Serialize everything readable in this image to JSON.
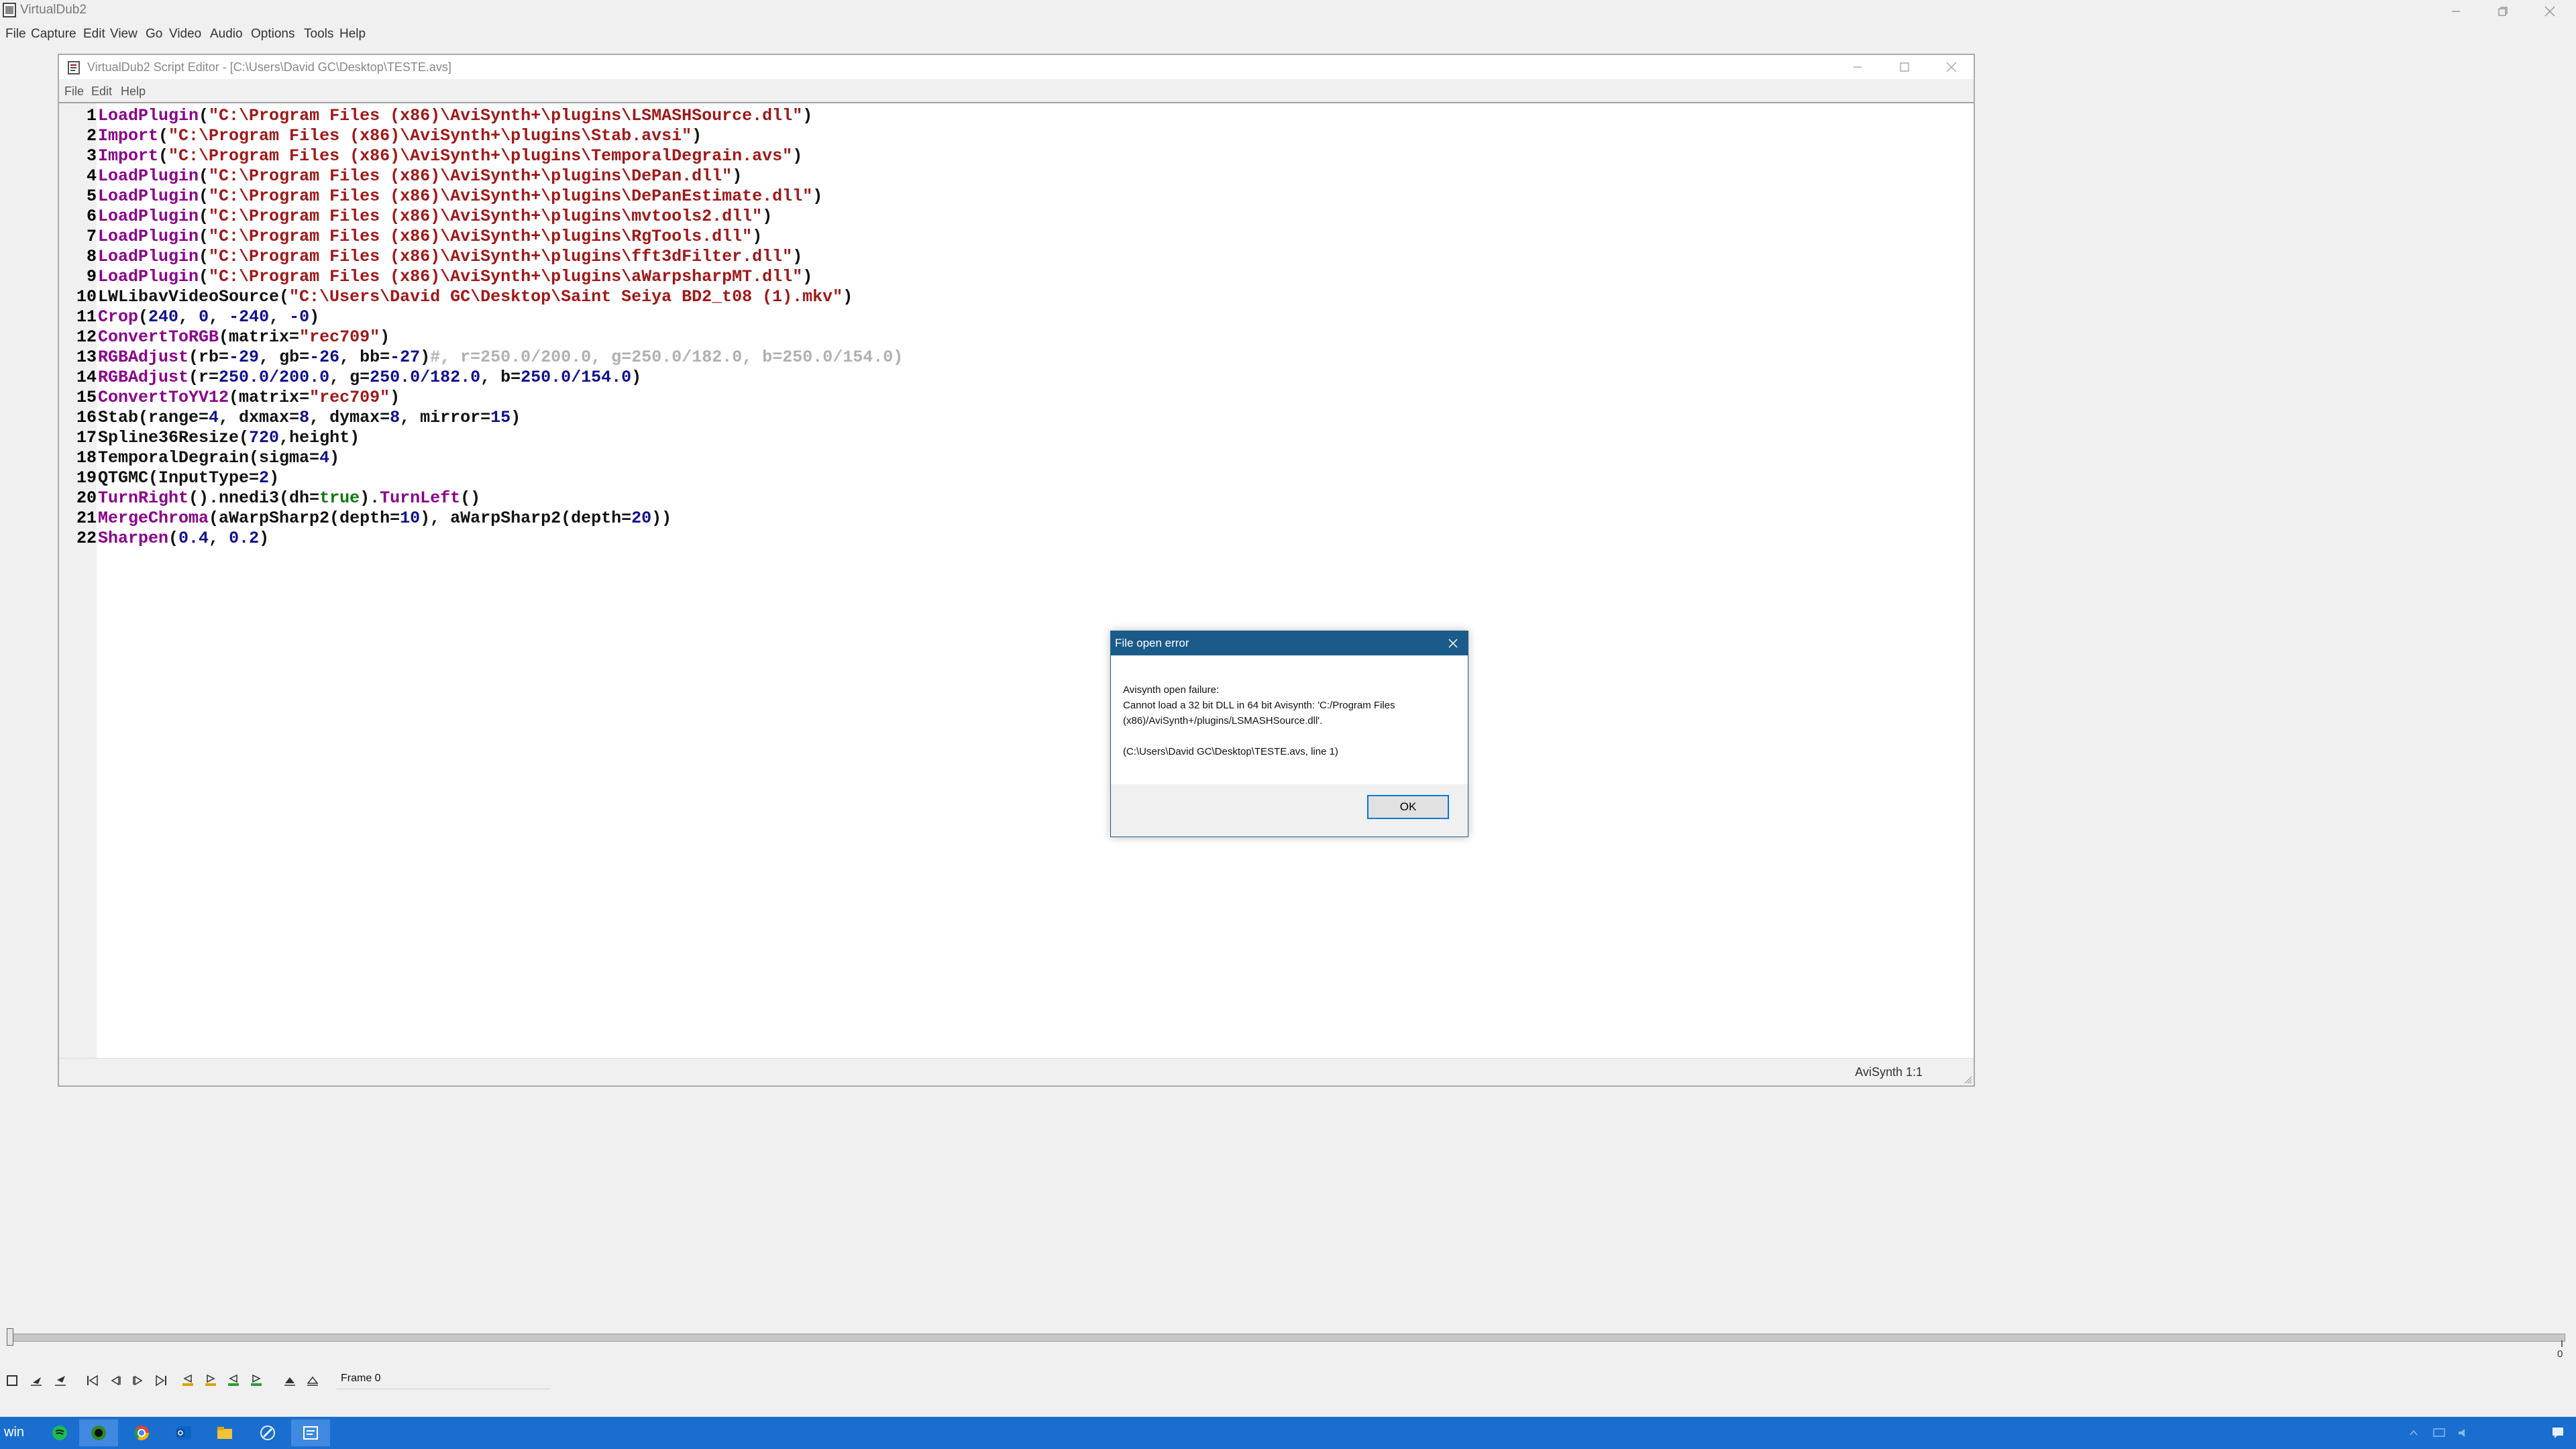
{
  "window": {
    "title": "VirtualDub2"
  },
  "menu": [
    "File",
    "Capture",
    "Edit",
    "View",
    "Go",
    "Video",
    "Audio",
    "Options",
    "Tools",
    "Help"
  ],
  "editor": {
    "title": "VirtualDub2 Script Editor - [C:\\Users\\David GC\\Desktop\\TESTE.avs]",
    "menu": [
      "File",
      "Edit",
      "Help"
    ],
    "status": "AviSynth 1:1",
    "lines": [
      {
        "num": "1",
        "tokens": [
          [
            "LoadPlugin",
            "purple"
          ],
          [
            "(",
            "black"
          ],
          [
            "\"C:\\Program Files (x86)\\AviSynth+\\plugins\\LSMASHSource.dll\"",
            "red"
          ],
          [
            ")",
            "black"
          ]
        ]
      },
      {
        "num": "2",
        "tokens": [
          [
            "Import",
            "purple"
          ],
          [
            "(",
            "black"
          ],
          [
            "\"C:\\Program Files (x86)\\AviSynth+\\plugins\\Stab.avsi\"",
            "red"
          ],
          [
            ")",
            "black"
          ]
        ]
      },
      {
        "num": "3",
        "tokens": [
          [
            "Import",
            "purple"
          ],
          [
            "(",
            "black"
          ],
          [
            "\"C:\\Program Files (x86)\\AviSynth+\\plugins\\TemporalDegrain.avs\"",
            "red"
          ],
          [
            ")",
            "black"
          ]
        ]
      },
      {
        "num": "4",
        "tokens": [
          [
            "LoadPlugin",
            "purple"
          ],
          [
            "(",
            "black"
          ],
          [
            "\"C:\\Program Files (x86)\\AviSynth+\\plugins\\DePan.dll\"",
            "red"
          ],
          [
            ")",
            "black"
          ]
        ]
      },
      {
        "num": "5",
        "tokens": [
          [
            "LoadPlugin",
            "purple"
          ],
          [
            "(",
            "black"
          ],
          [
            "\"C:\\Program Files (x86)\\AviSynth+\\plugins\\DePanEstimate.dll\"",
            "red"
          ],
          [
            ")",
            "black"
          ]
        ]
      },
      {
        "num": "6",
        "tokens": [
          [
            "LoadPlugin",
            "purple"
          ],
          [
            "(",
            "black"
          ],
          [
            "\"C:\\Program Files (x86)\\AviSynth+\\plugins\\mvtools2.dll\"",
            "red"
          ],
          [
            ")",
            "black"
          ]
        ]
      },
      {
        "num": "7",
        "tokens": [
          [
            "LoadPlugin",
            "purple"
          ],
          [
            "(",
            "black"
          ],
          [
            "\"C:\\Program Files (x86)\\AviSynth+\\plugins\\RgTools.dll\"",
            "red"
          ],
          [
            ")",
            "black"
          ]
        ]
      },
      {
        "num": "8",
        "tokens": [
          [
            "LoadPlugin",
            "purple"
          ],
          [
            "(",
            "black"
          ],
          [
            "\"C:\\Program Files (x86)\\AviSynth+\\plugins\\fft3dFilter.dll\"",
            "red"
          ],
          [
            ")",
            "black"
          ]
        ]
      },
      {
        "num": "9",
        "tokens": [
          [
            "LoadPlugin",
            "purple"
          ],
          [
            "(",
            "black"
          ],
          [
            "\"C:\\Program Files (x86)\\AviSynth+\\plugins\\aWarpsharpMT.dll\"",
            "red"
          ],
          [
            ")",
            "black"
          ]
        ]
      },
      {
        "num": "10",
        "tokens": [
          [
            "LWLibavVideoSource(",
            "black"
          ],
          [
            "\"C:\\Users\\David GC\\Desktop\\Saint Seiya BD2_t08 (1).mkv\"",
            "red"
          ],
          [
            ")",
            "black"
          ]
        ]
      },
      {
        "num": "11",
        "tokens": [
          [
            "Crop",
            "purple"
          ],
          [
            "(",
            "black"
          ],
          [
            "240",
            "blue"
          ],
          [
            ", ",
            "black"
          ],
          [
            "0",
            "blue"
          ],
          [
            ", ",
            "black"
          ],
          [
            "-240",
            "blue"
          ],
          [
            ", ",
            "black"
          ],
          [
            "-0",
            "blue"
          ],
          [
            ")",
            "black"
          ]
        ]
      },
      {
        "num": "12",
        "tokens": [
          [
            "ConvertToRGB",
            "purple"
          ],
          [
            "(matrix=",
            "black"
          ],
          [
            "\"rec709\"",
            "red"
          ],
          [
            ")",
            "black"
          ]
        ]
      },
      {
        "num": "13",
        "tokens": [
          [
            "RGBAdjust",
            "purple"
          ],
          [
            "(rb=",
            "black"
          ],
          [
            "-29",
            "blue"
          ],
          [
            ", gb=",
            "black"
          ],
          [
            "-26",
            "blue"
          ],
          [
            ", bb=",
            "black"
          ],
          [
            "-27",
            "blue"
          ],
          [
            ")",
            "black"
          ],
          [
            "#, r=250.0/200.0, g=250.0/182.0, b=250.0/154.0)",
            "gray"
          ]
        ]
      },
      {
        "num": "14",
        "tokens": [
          [
            "RGBAdjust",
            "purple"
          ],
          [
            "(r=",
            "black"
          ],
          [
            "250.0/200.0",
            "blue"
          ],
          [
            ", g=",
            "black"
          ],
          [
            "250.0/182.0",
            "blue"
          ],
          [
            ", b=",
            "black"
          ],
          [
            "250.0/154.0",
            "blue"
          ],
          [
            ")",
            "black"
          ]
        ]
      },
      {
        "num": "15",
        "tokens": [
          [
            "ConvertToYV12",
            "purple"
          ],
          [
            "(matrix=",
            "black"
          ],
          [
            "\"rec709\"",
            "red"
          ],
          [
            ")",
            "black"
          ]
        ]
      },
      {
        "num": "16",
        "tokens": [
          [
            "Stab(range=",
            "black"
          ],
          [
            "4",
            "blue"
          ],
          [
            ", dxmax=",
            "black"
          ],
          [
            "8",
            "blue"
          ],
          [
            ", dymax=",
            "black"
          ],
          [
            "8",
            "blue"
          ],
          [
            ", mirror=",
            "black"
          ],
          [
            "15",
            "blue"
          ],
          [
            ")",
            "black"
          ]
        ]
      },
      {
        "num": "17",
        "tokens": [
          [
            "Spline36Resize(",
            "black"
          ],
          [
            "720",
            "blue"
          ],
          [
            ",height)",
            "black"
          ]
        ]
      },
      {
        "num": "18",
        "tokens": [
          [
            "TemporalDegrain(sigma=",
            "black"
          ],
          [
            "4",
            "blue"
          ],
          [
            ")",
            "black"
          ]
        ]
      },
      {
        "num": "19",
        "tokens": [
          [
            "QTGMC(InputType=",
            "black"
          ],
          [
            "2",
            "blue"
          ],
          [
            ")",
            "black"
          ]
        ]
      },
      {
        "num": "20",
        "tokens": [
          [
            "TurnRight",
            "purple"
          ],
          [
            "().nnedi3(dh=",
            "black"
          ],
          [
            "true",
            "green"
          ],
          [
            ").",
            "black"
          ],
          [
            "TurnLeft",
            "purple"
          ],
          [
            "()",
            "black"
          ]
        ]
      },
      {
        "num": "21",
        "tokens": [
          [
            "MergeChroma",
            "purple"
          ],
          [
            "(aWarpSharp2(depth=",
            "black"
          ],
          [
            "10",
            "blue"
          ],
          [
            "), aWarpSharp2(depth=",
            "black"
          ],
          [
            "20",
            "blue"
          ],
          [
            "))",
            "black"
          ]
        ]
      },
      {
        "num": "22",
        "tokens": [
          [
            "Sharpen",
            "purple"
          ],
          [
            "(",
            "black"
          ],
          [
            "0.4",
            "blue"
          ],
          [
            ", ",
            "black"
          ],
          [
            "0.2",
            "blue"
          ],
          [
            ")",
            "black"
          ]
        ]
      }
    ]
  },
  "dialog": {
    "title": "File open error",
    "line1": "Avisynth open failure:",
    "line2": "Cannot load a 32 bit DLL in 64 bit Avisynth: 'C:/Program Files",
    "line3": "(x86)/AviSynth+/plugins/LSMASHSource.dll'.",
    "line4": "(C:\\Users\\David GC\\Desktop\\TESTE.avs, line 1)",
    "ok_label": "OK"
  },
  "timeline": {
    "end_label": "0"
  },
  "toolbar": {
    "frame_label": "Frame 0"
  },
  "taskbar": {
    "start_label": "win"
  },
  "colors": {
    "purple": "#8b008b",
    "red": "#a01818",
    "blue": "#101090",
    "black": "#111111",
    "green": "#117711",
    "gray": "#b0b0b0",
    "dialog_title_bg": "#1b5b8a",
    "taskbar_bg": "#1a6ed0"
  }
}
